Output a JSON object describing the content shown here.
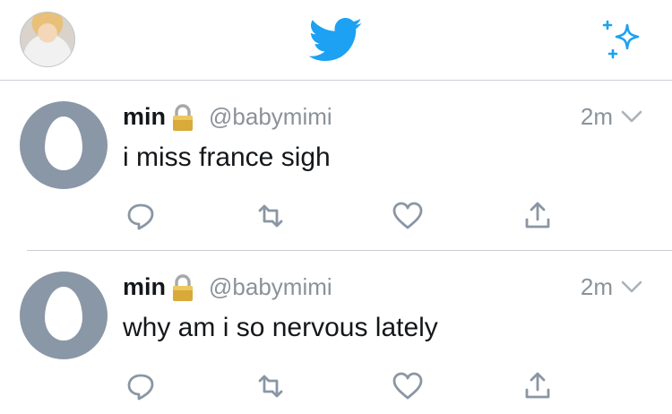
{
  "app": {
    "logo_icon": "twitter-bird-icon",
    "new_tweet_icon": "sparkle-icon",
    "brand_color": "#1da1f2"
  },
  "tweets": [
    {
      "name": "min",
      "lock_icon": "padlock-icon",
      "handle": "@babymimi",
      "time": "2m",
      "text": "i miss france sigh"
    },
    {
      "name": "min",
      "lock_icon": "padlock-icon",
      "handle": "@babymimi",
      "time": "2m",
      "text": "why am i so nervous lately"
    }
  ],
  "action_icons": [
    "reply-icon",
    "retweet-icon",
    "like-icon",
    "share-icon"
  ]
}
